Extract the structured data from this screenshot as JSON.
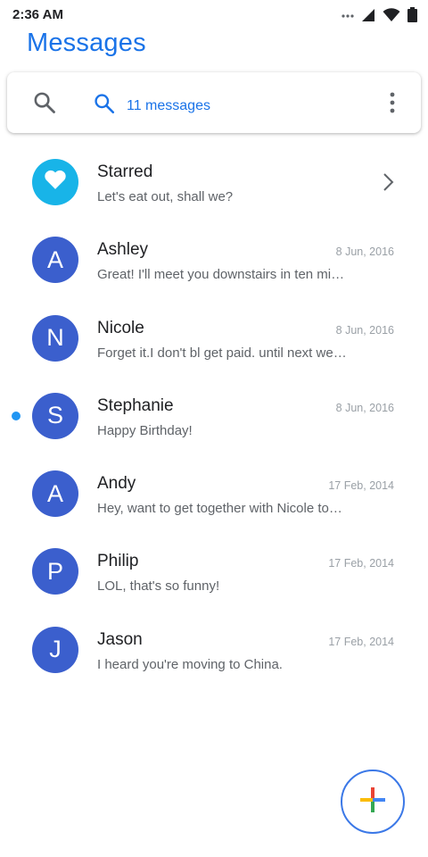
{
  "status_bar": {
    "time": "2:36 AM",
    "icons": [
      "notification-dots-icon",
      "signal-icon",
      "wifi-icon",
      "battery-icon"
    ]
  },
  "app": {
    "title": "Messages",
    "accent_color": "#1a73e8"
  },
  "search": {
    "query": "11 messages",
    "icons": [
      "search-icon",
      "overflow-menu-icon"
    ]
  },
  "conversations": [
    {
      "type": "starred",
      "avatar_icon": "heart-icon",
      "avatar_color": "#18b4e8",
      "name": "Starred",
      "snippet": "Let's eat out, shall we?",
      "trailing_icon": "chevron-right-icon",
      "unread": false
    },
    {
      "avatar": "A",
      "avatar_color": "#3b5fcd",
      "name": "Ashley",
      "snippet": "Great! I'll meet you downstairs in ten minutes.",
      "date": "8 Jun, 2016",
      "unread": false
    },
    {
      "avatar": "N",
      "avatar_color": "#3b5fcd",
      "name": "Nicole",
      "snippet": "Forget it.I don't bl get paid. until next week.",
      "date": "8 Jun, 2016",
      "unread": false
    },
    {
      "avatar": "S",
      "avatar_color": "#3b5fcd",
      "name": "Stephanie",
      "snippet": "Happy Birthday!",
      "date": "8 Jun, 2016",
      "unread": true
    },
    {
      "avatar": "A",
      "avatar_color": "#3b5fcd",
      "name": "Andy",
      "snippet": "Hey, want to get together with Nicole tonight?",
      "date": "17 Feb, 2014",
      "unread": false
    },
    {
      "avatar": "P",
      "avatar_color": "#3b5fcd",
      "name": "Philip",
      "snippet": "LOL, that's so funny!",
      "date": "17 Feb, 2014",
      "unread": false
    },
    {
      "avatar": "J",
      "avatar_color": "#3b5fcd",
      "name": "Jason",
      "snippet": "I heard you're moving to China.",
      "date": "17 Feb, 2014",
      "unread": false
    }
  ],
  "fab": {
    "icon": "google-plus-icon",
    "colors": [
      "#ea4335",
      "#fbbc05",
      "#34a853",
      "#4285f4"
    ]
  }
}
